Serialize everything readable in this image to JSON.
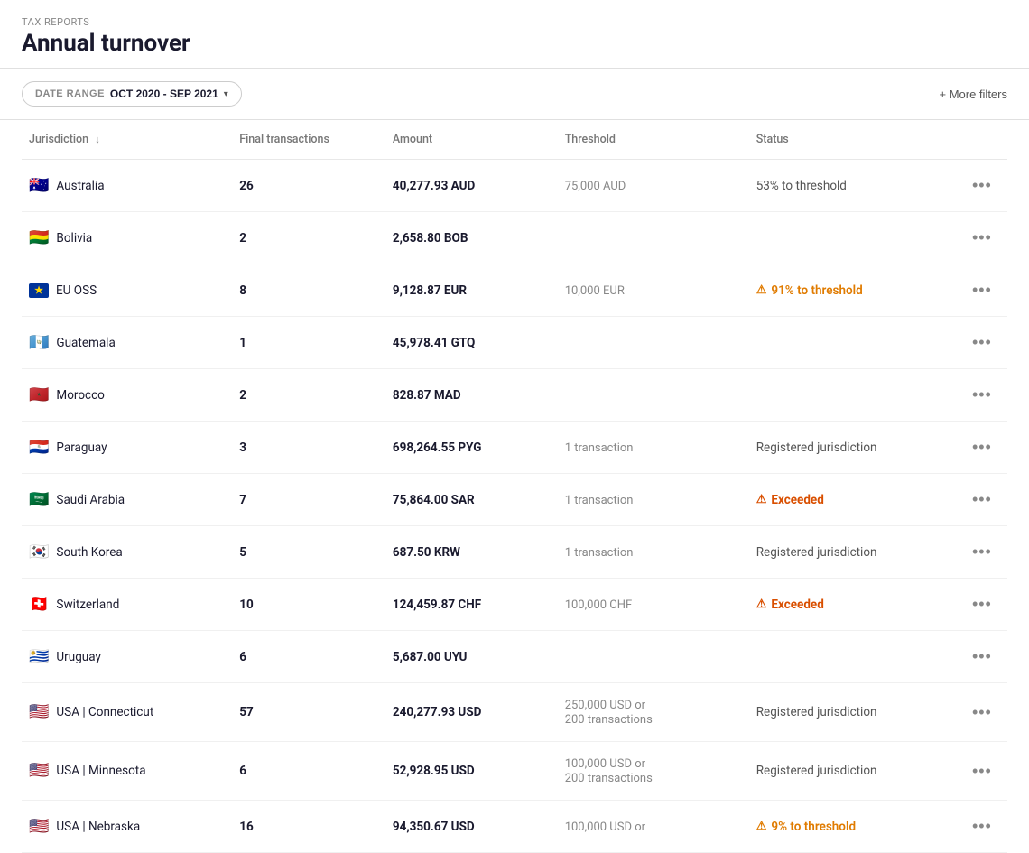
{
  "breadcrumb": "TAX REPORTS",
  "page_title": "Annual turnover",
  "date_range": {
    "label": "DATE RANGE",
    "value": "OCT 2020 - SEP 2021"
  },
  "more_filters_label": "+ More filters",
  "table": {
    "columns": [
      {
        "id": "jurisdiction",
        "label": "Jurisdiction",
        "sortable": true
      },
      {
        "id": "transactions",
        "label": "Final transactions",
        "sortable": false
      },
      {
        "id": "amount",
        "label": "Amount",
        "sortable": false
      },
      {
        "id": "threshold",
        "label": "Threshold",
        "sortable": false
      },
      {
        "id": "status",
        "label": "Status",
        "sortable": false
      },
      {
        "id": "actions",
        "label": "",
        "sortable": false
      }
    ],
    "rows": [
      {
        "jurisdiction": "Australia",
        "flag_type": "emoji",
        "flag": "🇦🇺",
        "transactions": "26",
        "amount": "40,277.93 AUD",
        "threshold": "75,000 AUD",
        "status": "53% to threshold",
        "status_type": "normal"
      },
      {
        "jurisdiction": "Bolivia",
        "flag_type": "emoji",
        "flag": "🇧🇴",
        "transactions": "2",
        "amount": "2,658.80 BOB",
        "threshold": "",
        "status": "",
        "status_type": "none"
      },
      {
        "jurisdiction": "EU OSS",
        "flag_type": "eu",
        "flag": "EU",
        "transactions": "8",
        "amount": "9,128.87 EUR",
        "threshold": "10,000 EUR",
        "status": "91% to threshold",
        "status_type": "warning"
      },
      {
        "jurisdiction": "Guatemala",
        "flag_type": "emoji",
        "flag": "🇬🇹",
        "transactions": "1",
        "amount": "45,978.41 GTQ",
        "threshold": "",
        "status": "",
        "status_type": "none"
      },
      {
        "jurisdiction": "Morocco",
        "flag_type": "emoji",
        "flag": "🇲🇦",
        "transactions": "2",
        "amount": "828.87 MAD",
        "threshold": "",
        "status": "",
        "status_type": "none"
      },
      {
        "jurisdiction": "Paraguay",
        "flag_type": "emoji",
        "flag": "🇵🇾",
        "transactions": "3",
        "amount": "698,264.55 PYG",
        "threshold": "1 transaction",
        "status": "Registered jurisdiction",
        "status_type": "normal"
      },
      {
        "jurisdiction": "Saudi Arabia",
        "flag_type": "emoji",
        "flag": "🇸🇦",
        "transactions": "7",
        "amount": "75,864.00 SAR",
        "threshold": "1 transaction",
        "status": "Exceeded",
        "status_type": "exceeded"
      },
      {
        "jurisdiction": "South Korea",
        "flag_type": "emoji",
        "flag": "🇰🇷",
        "transactions": "5",
        "amount": "687.50 KRW",
        "threshold": "1 transaction",
        "status": "Registered jurisdiction",
        "status_type": "normal"
      },
      {
        "jurisdiction": "Switzerland",
        "flag_type": "emoji",
        "flag": "🇨🇭",
        "transactions": "10",
        "amount": "124,459.87 CHF",
        "threshold": "100,000 CHF",
        "status": "Exceeded",
        "status_type": "exceeded"
      },
      {
        "jurisdiction": "Uruguay",
        "flag_type": "emoji",
        "flag": "🇺🇾",
        "transactions": "6",
        "amount": "5,687.00 UYU",
        "threshold": "",
        "status": "",
        "status_type": "none"
      },
      {
        "jurisdiction": "USA | Connecticut",
        "flag_type": "emoji",
        "flag": "🇺🇸",
        "transactions": "57",
        "amount": "240,277.93 USD",
        "threshold": "250,000 USD or\n200 transactions",
        "status": "Registered jurisdiction",
        "status_type": "normal"
      },
      {
        "jurisdiction": "USA | Minnesota",
        "flag_type": "emoji",
        "flag": "🇺🇸",
        "transactions": "6",
        "amount": "52,928.95 USD",
        "threshold": "100,000 USD or\n200 transactions",
        "status": "Registered jurisdiction",
        "status_type": "normal"
      },
      {
        "jurisdiction": "USA | Nebraska",
        "flag_type": "emoji",
        "flag": "🇺🇸",
        "transactions": "16",
        "amount": "94,350.67 USD",
        "threshold": "100,000 USD or",
        "status": "9% to threshold",
        "status_type": "warning_partial"
      }
    ]
  },
  "actions_btn_label": "•••"
}
